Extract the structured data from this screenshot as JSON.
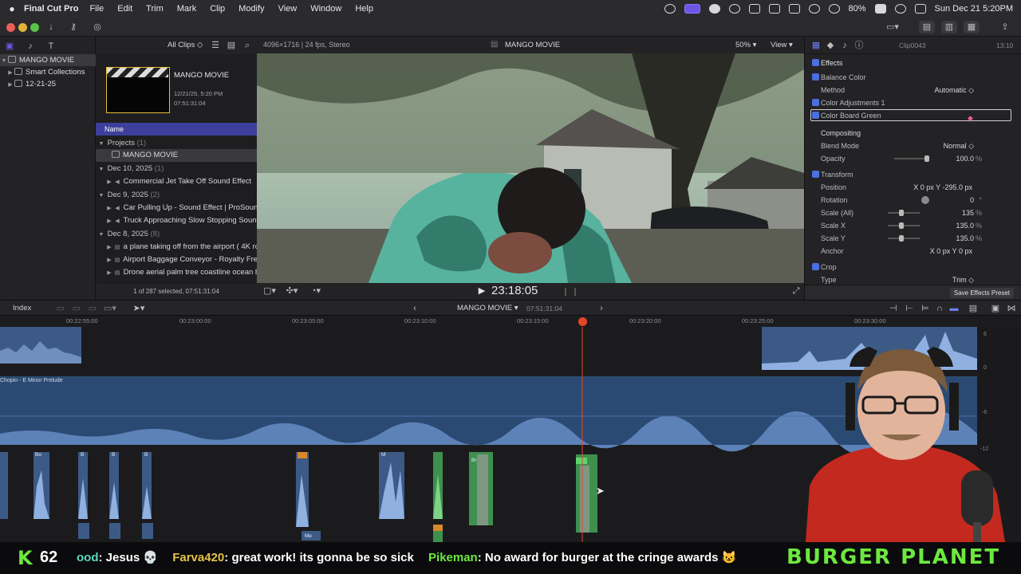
{
  "menubar": {
    "app": "Final Cut Pro",
    "menus": [
      "File",
      "Edit",
      "Trim",
      "Mark",
      "Clip",
      "Modify",
      "View",
      "Window",
      "Help"
    ],
    "battery": "80%",
    "datetime": "Sun Dec 21  5:20PM"
  },
  "library": {
    "items": [
      {
        "label": "MANGO MOVIE",
        "selected": true
      },
      {
        "label": "Smart Collections",
        "selected": false
      },
      {
        "label": "12-21-25",
        "selected": false
      }
    ]
  },
  "browser": {
    "filter": "All Clips",
    "project_card": {
      "title": "MANGO MOVIE",
      "date": "12/21/25, 5:20 PM",
      "duration": "07:51:31:04"
    },
    "column_header": "Name",
    "rows": [
      {
        "kind": "group",
        "label": "Projects",
        "count": "(1)"
      },
      {
        "kind": "item",
        "label": "MANGO MOVIE",
        "selected": true
      },
      {
        "kind": "group",
        "label": "Dec 10, 2025",
        "count": "(1)"
      },
      {
        "kind": "item",
        "label": "Commercial Jet Take Off Sound Effect"
      },
      {
        "kind": "group",
        "label": "Dec 9, 2025",
        "count": "(2)"
      },
      {
        "kind": "item",
        "label": "Car Pulling Up - Sound Effect  |  ProSound"
      },
      {
        "kind": "item",
        "label": "Truck Approaching Slow Stopping Sound"
      },
      {
        "kind": "group",
        "label": "Dec 8, 2025",
        "count": "(8)"
      },
      {
        "kind": "item",
        "label": "a plane taking off from the airport ( 4K ro"
      },
      {
        "kind": "item",
        "label": "Airport Baggage Conveyor - Royalty Free"
      },
      {
        "kind": "item",
        "label": "Drone aerial palm tree coastline ocean be"
      }
    ],
    "status": "1 of 287 selected, 07:51:31:04"
  },
  "viewer": {
    "format": "4096×1716 | 24 fps, Stereo",
    "title": "MANGO MOVIE",
    "zoom": "50%",
    "view_menu": "View",
    "timecode": "23:18:05"
  },
  "inspector": {
    "clip_name": "Clip0043",
    "clip_duration": "13:10",
    "effects_header": "Effects",
    "rows": [
      {
        "label": "Balance Color",
        "checkbox": true,
        "value": ""
      },
      {
        "label": "Method",
        "value": "Automatic ◇"
      },
      {
        "label": "Color Adjustments 1",
        "checkbox": true,
        "value": ""
      },
      {
        "label": "Color Board Green",
        "checkbox": true,
        "value": ""
      },
      {
        "label": "Compositing",
        "value": ""
      },
      {
        "label": "Blend Mode",
        "value": "Normal ◇"
      },
      {
        "label": "Opacity",
        "value": "100.0",
        "unit": "%"
      },
      {
        "label": "Transform",
        "checkbox": true,
        "value": ""
      },
      {
        "label": "Position",
        "value": "X  0 px  Y  -295.0 px"
      },
      {
        "label": "Rotation",
        "value": "0",
        "unit": "°"
      },
      {
        "label": "Scale (All)",
        "value": "135",
        "unit": "%"
      },
      {
        "label": "Scale X",
        "value": "135.0",
        "unit": "%"
      },
      {
        "label": "Scale Y",
        "value": "135.0",
        "unit": "%"
      },
      {
        "label": "Anchor",
        "value": "X  0 px  Y  0 px"
      },
      {
        "label": "Crop",
        "checkbox": true,
        "value": ""
      },
      {
        "label": "Type",
        "value": "Trim ◇"
      }
    ],
    "save_preset": "Save Effects Preset"
  },
  "timeline": {
    "index_label": "Index",
    "project": "MANGO MOVIE",
    "duration": "07:51:31:04",
    "ruler": [
      "00:22:55:00",
      "00:23:00:00",
      "00:23:05:00",
      "00:23:10:00",
      "00:23:15:00",
      "00:23:20:00",
      "00:23:25:00",
      "00:23:30:00"
    ],
    "music_clip": "Chopin - E Minor Prelude",
    "small_labels": [
      "Bo",
      "B",
      "B",
      "B",
      "M",
      "Br",
      "Me"
    ],
    "meter_labels": [
      "6",
      "0",
      "-6",
      "-12"
    ]
  },
  "ticker": {
    "badge_letter": "K",
    "badge_count": "62",
    "messages": [
      {
        "user": "ood",
        "text": ": Jesus 💀"
      },
      {
        "user": "Farva420",
        "text": ": great work! its gonna be so sick"
      },
      {
        "user": "Pikeman",
        "text": ": No award for burger at the cringe awards 😺"
      }
    ],
    "brand": "BURGER PLANET"
  },
  "colors": {
    "accent": "#6e55e6",
    "selection": "#3c3f9c",
    "playhead": "#e5452a",
    "audio_clip": "#3d5a86",
    "ticker_green": "#6de83f",
    "ticker_name": "#e6c34a",
    "ticker_name2": "#5ed8c0"
  }
}
